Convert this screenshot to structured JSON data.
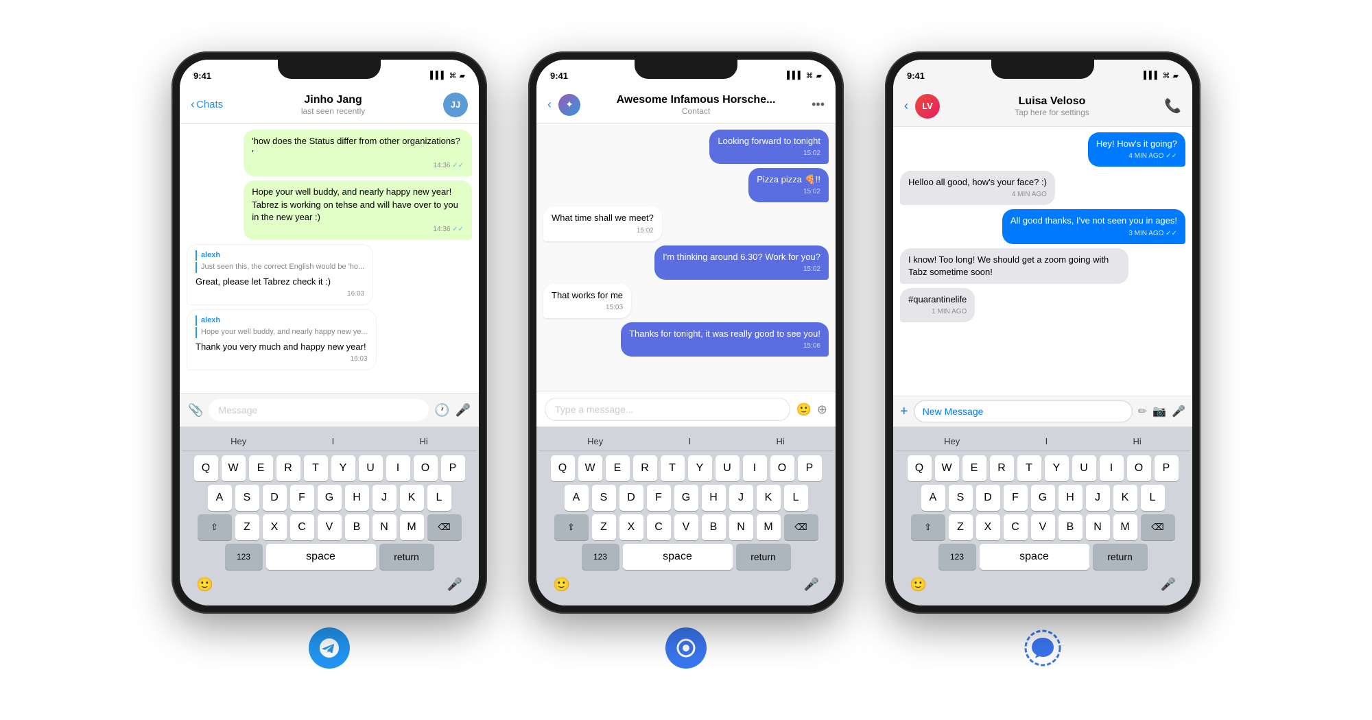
{
  "phones": [
    {
      "id": "telegram",
      "status_time": "9:41",
      "header": {
        "back_label": "Chats",
        "contact_name": "Jinho Jang",
        "contact_sub": "last seen recently",
        "avatar_initials": "JJ"
      },
      "messages": [
        {
          "type": "sent",
          "text": "'how does the Status differ from other organizations? '",
          "time": "14:36",
          "check": "✓✓"
        },
        {
          "type": "sent",
          "text": "Hope your well buddy, and nearly happy new year! Tabrez is working on tehse and will have over to you in the new year :)",
          "time": "14:36",
          "check": "✓✓"
        },
        {
          "type": "received",
          "reply_from": "alexh",
          "reply_preview": "Just seen this, the correct English would be 'ho...",
          "text": "Great, please let Tabrez check it :)",
          "time": "16:03"
        },
        {
          "type": "received",
          "reply_from": "alexh",
          "reply_preview": "Hope your well buddy, and nearly happy new ye...",
          "text": "Thank you very much and happy new year!",
          "time": "16:03"
        }
      ],
      "input_placeholder": "Message",
      "keyboard": {
        "suggestions": [
          "Hey",
          "I",
          "Hi"
        ],
        "rows": [
          [
            "Q",
            "W",
            "E",
            "R",
            "T",
            "Y",
            "U",
            "I",
            "O",
            "P"
          ],
          [
            "A",
            "S",
            "D",
            "F",
            "G",
            "H",
            "J",
            "K",
            "L"
          ],
          [
            "⇧",
            "Z",
            "X",
            "C",
            "V",
            "B",
            "N",
            "M",
            "⌫"
          ],
          [
            "123",
            "space",
            "return"
          ]
        ]
      },
      "app_icon_type": "telegram"
    },
    {
      "id": "bobble",
      "status_time": "9:41",
      "header": {
        "contact_name": "Awesome Infamous Horsche...",
        "contact_sub": "Contact",
        "more": "•••"
      },
      "messages": [
        {
          "type": "sent-blue",
          "text": "Looking forward to tonight",
          "time": "15:02"
        },
        {
          "type": "sent-blue",
          "text": "Pizza pizza 🍕!! ",
          "time": "15:02"
        },
        {
          "type": "received",
          "text": "What time shall we meet?",
          "time": "15:02"
        },
        {
          "type": "sent-blue",
          "text": "I'm thinking around 6.30? Work for you?",
          "time": "15:02"
        },
        {
          "type": "received",
          "text": "That works for me",
          "time": "15:03"
        },
        {
          "type": "sent-blue",
          "text": "Thanks for tonight, it was really good to see you!",
          "time": "15:06"
        }
      ],
      "input_placeholder": "Type a message...",
      "keyboard": {
        "suggestions": [
          "Hey",
          "I",
          "Hi"
        ],
        "rows": [
          [
            "Q",
            "W",
            "E",
            "R",
            "T",
            "Y",
            "U",
            "I",
            "O",
            "P"
          ],
          [
            "A",
            "S",
            "D",
            "F",
            "G",
            "H",
            "J",
            "K",
            "L"
          ],
          [
            "⇧",
            "Z",
            "X",
            "C",
            "V",
            "B",
            "N",
            "M",
            "⌫"
          ],
          [
            "123",
            "space",
            "return"
          ]
        ]
      },
      "app_icon_type": "bobble"
    },
    {
      "id": "imessage",
      "status_time": "9:41",
      "header": {
        "contact_name": "Luisa Veloso",
        "contact_sub": "Tap here for settings",
        "avatar_initials": "LV"
      },
      "messages": [
        {
          "type": "sent-imessage",
          "text": "Hey! How's it going?",
          "time": "4 MIN AGO",
          "check": "✓✓"
        },
        {
          "type": "received-imessage",
          "text": "Helloo all good, how's your face? :)",
          "time": "4 MIN AGO"
        },
        {
          "type": "sent-imessage",
          "text": "All good thanks, I've not seen you in ages!",
          "time": "3 MIN AGO",
          "check": "✓✓"
        },
        {
          "type": "received-imessage",
          "text": "I know! Too long! We should get a zoom going with Tabz sometime soon!",
          "time": ""
        },
        {
          "type": "received-imessage",
          "text": "#quarantinelife",
          "time": "1 MIN AGO"
        }
      ],
      "input_placeholder": "New Message",
      "keyboard": {
        "suggestions": [
          "Hey",
          "I",
          "Hi"
        ],
        "rows": [
          [
            "Q",
            "W",
            "E",
            "R",
            "T",
            "Y",
            "U",
            "I",
            "O",
            "P"
          ],
          [
            "A",
            "S",
            "D",
            "F",
            "G",
            "H",
            "J",
            "K",
            "L"
          ],
          [
            "⇧",
            "Z",
            "X",
            "C",
            "V",
            "B",
            "N",
            "M",
            "⌫"
          ],
          [
            "123",
            "space",
            "return"
          ]
        ]
      },
      "app_icon_type": "isignal"
    }
  ]
}
